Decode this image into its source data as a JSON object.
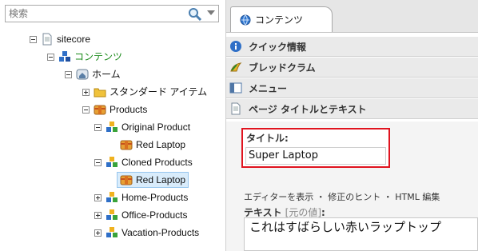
{
  "search": {
    "placeholder": "検索"
  },
  "tree": {
    "items": [
      {
        "label": "sitecore"
      },
      {
        "label": "コンテンツ"
      },
      {
        "label": "ホーム"
      },
      {
        "label": "スタンダード アイテム"
      },
      {
        "label": "Products"
      },
      {
        "label": "Original Product"
      },
      {
        "label": "Red Laptop"
      },
      {
        "label": "Cloned Products"
      },
      {
        "label": "Red Laptop"
      },
      {
        "label": "Home-Products"
      },
      {
        "label": "Office-Products"
      },
      {
        "label": "Vacation-Products"
      }
    ]
  },
  "editor": {
    "tab_label": "コンテンツ",
    "sections": [
      {
        "label": "クイック情報"
      },
      {
        "label": "ブレッドクラム"
      },
      {
        "label": "メニュー"
      },
      {
        "label": "ページ タイトルとテキスト"
      }
    ],
    "title_field": {
      "label": "タイトル:",
      "value": "Super Laptop"
    },
    "editor_links": "エディターを表示 ・ 修正のヒント ・ HTML 編集",
    "text_field": {
      "label": "テキスト",
      "original_link": "[元の値]",
      "colon": ":",
      "value": "これはすばらしい赤いラップトップ"
    }
  },
  "colors": {
    "highlight_border": "#e0141f",
    "selection": "#d9ecfb",
    "tree_green": "#1a8a1a"
  }
}
